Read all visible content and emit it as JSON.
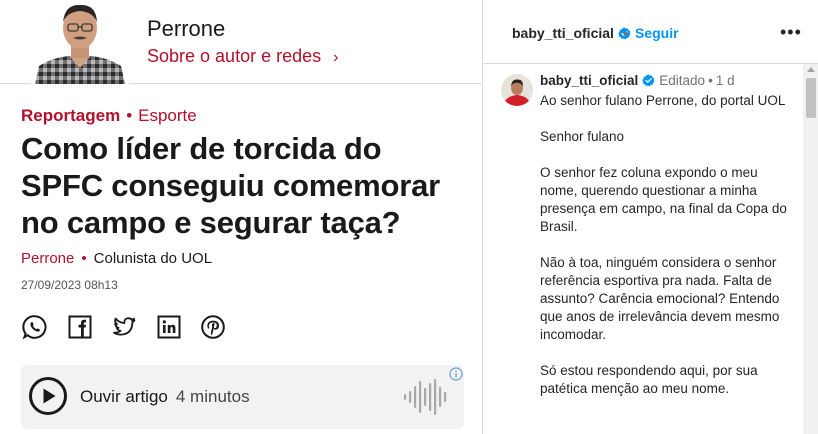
{
  "article": {
    "author_name": "Perrone",
    "author_link": "Sobre o autor e redes",
    "kicker_section": "Reportagem",
    "kicker_sub": "Esporte",
    "headline": "Como líder de torcida do SPFC conseguiu comemorar no campo e segurar taça?",
    "byline_name": "Perrone",
    "byline_role": "Colunista do UOL",
    "date": "27/09/2023 08h13",
    "share_icons": [
      "whatsapp-icon",
      "facebook-icon",
      "twitter-icon",
      "linkedin-icon",
      "pinterest-icon"
    ],
    "player": {
      "label": "Ouvir artigo",
      "duration": "4 minutos"
    },
    "colors": {
      "accent": "#b2112b",
      "text": "#1a1a1a"
    }
  },
  "instagram": {
    "username": "baby_tti_oficial",
    "follow_label": "Seguir",
    "comment": {
      "username": "baby_tti_oficial",
      "edited_label": "Editado",
      "time": "1 d",
      "paragraphs": [
        "Ao senhor fulano Perrone, do portal UOL",
        "Senhor fulano",
        "O senhor fez coluna expondo o meu nome, querendo questionar a minha presença em campo, na final da Copa do Brasil.",
        "Não à toa, ninguém considera o senhor referência esportiva pra nada. Falta de assunto? Carência emocional? Entendo que anos de irrelevância devem mesmo incomodar.",
        "Só estou respondendo aqui, por sua patética menção ao meu nome."
      ]
    },
    "colors": {
      "link": "#0095f6",
      "verified": "#0095f6",
      "muted": "#737373"
    }
  }
}
